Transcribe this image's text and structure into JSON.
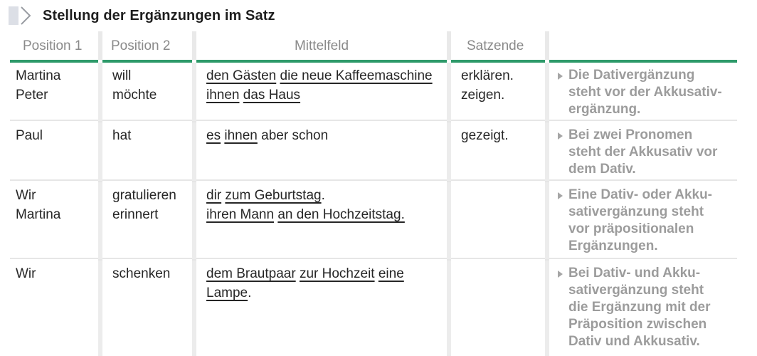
{
  "title": "Stellung der Ergänzungen im Satz",
  "headers": {
    "position1": "Position 1",
    "position2": "Position 2",
    "mittelfeld": "Mittelfeld",
    "satzende": "Satzende",
    "note": ""
  },
  "accent_color": "#2e9a6a",
  "rows": [
    {
      "pos1": [
        "Martina",
        "Peter"
      ],
      "pos2": [
        "will",
        "möchte"
      ],
      "mittelfeld": [
        [
          {
            "text": "den Gästen",
            "u": true
          },
          {
            "text": " ",
            "u": false
          },
          {
            "text": "die neue Kaffeemaschine",
            "u": true
          }
        ],
        [
          {
            "text": "ihnen",
            "u": true
          },
          {
            "text": " ",
            "u": false
          },
          {
            "text": "das Haus",
            "u": true
          }
        ]
      ],
      "satzende": [
        "erklären.",
        "zeigen."
      ],
      "note": "Die Dativergänzung\nsteht vor der Akkusativ-\nergänzung."
    },
    {
      "pos1": [
        "Paul"
      ],
      "pos2": [
        "hat"
      ],
      "mittelfeld": [
        [
          {
            "text": "es",
            "u": true
          },
          {
            "text": " ",
            "u": false
          },
          {
            "text": "ihnen",
            "u": true
          },
          {
            "text": " aber schon",
            "u": false
          }
        ]
      ],
      "satzende": [
        "gezeigt."
      ],
      "note": "Bei zwei Pronomen\nsteht der Akkusativ vor\ndem Dativ."
    },
    {
      "pos1": [
        "Wir",
        "Martina"
      ],
      "pos2": [
        "gratulieren",
        "erinnert"
      ],
      "mittelfeld": [
        [
          {
            "text": "dir",
            "u": true
          },
          {
            "text": " ",
            "u": false
          },
          {
            "text": "zum Geburtstag",
            "u": true
          },
          {
            "text": ".",
            "u": false
          }
        ],
        [
          {
            "text": "ihren Mann",
            "u": true
          },
          {
            "text": " ",
            "u": false
          },
          {
            "text": "an den Hochzeitstag.",
            "u": true
          }
        ]
      ],
      "satzende": [],
      "note": "Eine Dativ- oder Akku-\nsativergänzung steht\nvor präpositionalen\nErgänzungen."
    },
    {
      "pos1": [
        "Wir"
      ],
      "pos2": [
        "schenken"
      ],
      "mittelfeld": [
        [
          {
            "text": "dem Brautpaar",
            "u": true
          },
          {
            "text": " ",
            "u": false
          },
          {
            "text": "zur Hochzeit",
            "u": true
          },
          {
            "text": " ",
            "u": false
          },
          {
            "text": "eine",
            "u": true
          }
        ],
        [
          {
            "text": "Lampe",
            "u": true
          },
          {
            "text": ".",
            "u": false
          }
        ]
      ],
      "satzende": [],
      "note": "Bei Dativ- und Akku-\nsativergänzung steht\ndie Ergänzung mit der\nPräposition zwischen\nDativ und Akkusativ."
    }
  ]
}
